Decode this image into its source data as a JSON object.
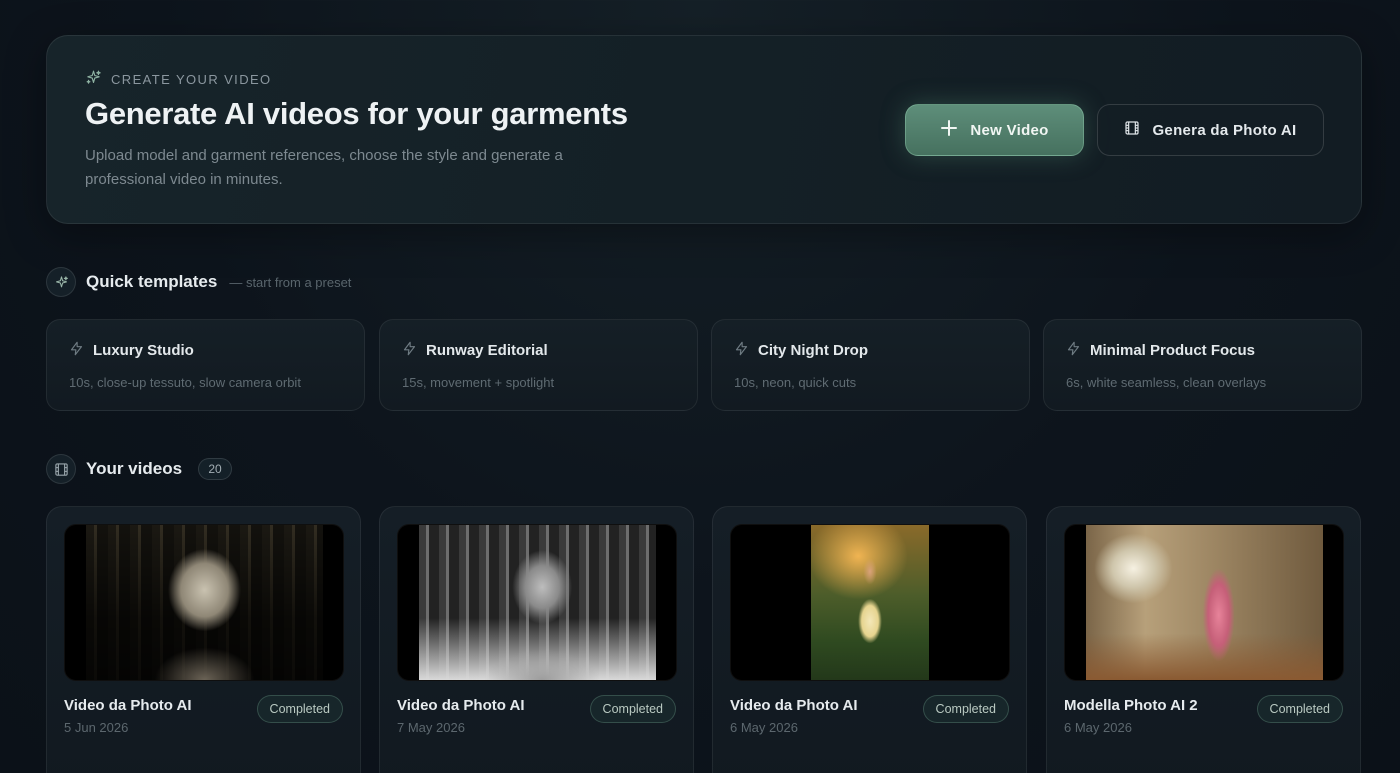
{
  "hero": {
    "kicker": "CREATE YOUR VIDEO",
    "title": "Generate AI videos for your garments",
    "subtitle": "Upload model and garment references, choose the style and generate a professional video in minutes.",
    "primary_button": "New Video",
    "secondary_button": "Genera da Photo AI"
  },
  "templates_section": {
    "title": "Quick templates",
    "hint": "— start from a preset",
    "items": [
      {
        "title": "Luxury Studio",
        "desc": "10s, close-up tessuto, slow camera orbit"
      },
      {
        "title": "Runway Editorial",
        "desc": "15s, movement + spotlight"
      },
      {
        "title": "City Night Drop",
        "desc": "10s, neon, quick cuts"
      },
      {
        "title": "Minimal Product Focus",
        "desc": "6s, white seamless, clean overlays"
      }
    ]
  },
  "videos_section": {
    "title": "Your videos",
    "count": "20",
    "items": [
      {
        "title": "Video da Photo AI",
        "date": "5 Jun 2026",
        "status": "Completed"
      },
      {
        "title": "Video da Photo AI",
        "date": "7 May 2026",
        "status": "Completed"
      },
      {
        "title": "Video da Photo AI",
        "date": "6 May 2026",
        "status": "Completed"
      },
      {
        "title": "Modella Photo AI 2",
        "date": "6 May 2026",
        "status": "Completed"
      }
    ]
  },
  "colors": {
    "background": "#0d141c",
    "accent": "#5e8e7a",
    "badge_text": "#b9c9c1"
  },
  "icons": {
    "kicker": "sparkle-icon",
    "primary_button": "plus-icon",
    "secondary_button": "film-icon",
    "templates_section": "sparkle-icon",
    "template_item": "bolt-icon",
    "videos_section": "film-icon"
  }
}
